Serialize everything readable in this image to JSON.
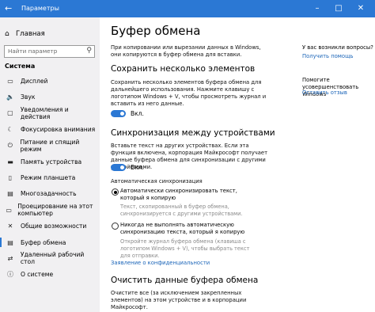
{
  "window": {
    "title": "Параметры",
    "controls": [
      "–",
      "□",
      "✕"
    ]
  },
  "sidebar": {
    "home_label": "Главная",
    "search_placeholder": "Найти параметр",
    "section_title": "Система",
    "items": [
      {
        "label": "Дисплей",
        "icon": "display-icon",
        "glyph": "▭"
      },
      {
        "label": "Звук",
        "icon": "sound-icon",
        "glyph": "🔈"
      },
      {
        "label": "Уведомления и действия",
        "icon": "notifications-icon",
        "glyph": "▢"
      },
      {
        "label": "Фокусировка внимания",
        "icon": "focus-assist-icon",
        "glyph": "☾"
      },
      {
        "label": "Питание и спящий режим",
        "icon": "power-icon",
        "glyph": "⏻"
      },
      {
        "label": "Память устройства",
        "icon": "storage-icon",
        "glyph": "▬"
      },
      {
        "label": "Режим планшета",
        "icon": "tablet-icon",
        "glyph": "▯"
      },
      {
        "label": "Многозадачность",
        "icon": "multitasking-icon",
        "glyph": "▤"
      },
      {
        "label": "Проецирование на этот компьютер",
        "icon": "projecting-icon",
        "glyph": "▭"
      },
      {
        "label": "Общие возможности",
        "icon": "shared-experiences-icon",
        "glyph": "✕"
      },
      {
        "label": "Буфер обмена",
        "icon": "clipboard-icon",
        "glyph": "▤",
        "active": true
      },
      {
        "label": "Удаленный рабочий стол",
        "icon": "remote-desktop-icon",
        "glyph": "⇄"
      },
      {
        "label": "О системе",
        "icon": "about-icon",
        "glyph": "ⓘ"
      }
    ]
  },
  "main": {
    "title": "Буфер обмена",
    "intro": "При копировании или вырезании данных в Windows, они копируются в буфер обмена для вставки.",
    "history": {
      "heading": "Сохранить несколько элементов",
      "desc": "Сохранить несколько элементов буфера обмена для дальнейшего использования. Нажмите клавишу с логотипом Windows + V, чтобы просмотреть журнал и вставить из него данные.",
      "toggle_label": "Вкл."
    },
    "sync": {
      "heading": "Синхронизация между устройствами",
      "desc": "Вставьте текст на других устройствах. Если эта функция включена, корпорация Майкрософт получает данные буфера обмена для синхронизации с другими устройствами.",
      "toggle_label": "Вкл.",
      "auto_heading": "Автоматическая синхронизация",
      "option_auto_label": "Автоматически синхронизировать текст, который я копирую",
      "option_auto_desc": "Текст, скопированный в буфер обмена, синхронизируется с другими устройствами.",
      "option_manual_label": "Никогда не выполнять автоматическую синхронизацию текста, который я копирую",
      "option_manual_desc": "Откройте журнал буфера обмена (клавиша с логотипом Windows + V), чтобы выбрать текст для отправки."
    },
    "privacy_link": "Заявление о конфиденциальности",
    "clear": {
      "heading": "Очистить данные буфера обмена",
      "desc": "Очистите все (за исключением закрепленных элементов) на этом устройстве и в корпорации Майкрософт."
    }
  },
  "right_pane": {
    "question": "У вас возникли вопросы?",
    "help_link": "Получить помощь",
    "improve": "Помогите усовершенствовать Windows",
    "feedback_link": "Оставить отзыв"
  }
}
